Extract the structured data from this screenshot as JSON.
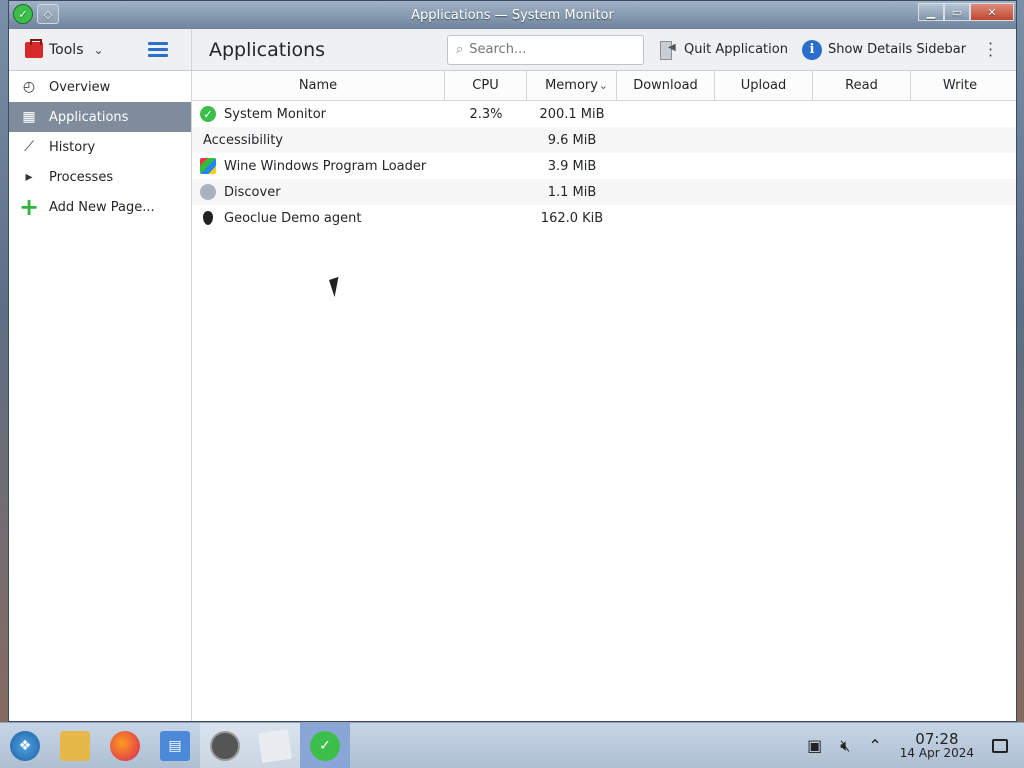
{
  "window": {
    "title": "Applications — System Monitor",
    "controls": {
      "minimize": "▁",
      "maximize": "▭",
      "close": "✕"
    }
  },
  "toolbar": {
    "tools_label": "Tools",
    "page_title": "Applications",
    "search_placeholder": "Search...",
    "quit_label": "Quit Application",
    "details_label": "Show Details Sidebar"
  },
  "sidebar": {
    "items": [
      {
        "label": "Overview",
        "icon": "gauge-icon",
        "selected": false
      },
      {
        "label": "Applications",
        "icon": "grid-icon",
        "selected": true
      },
      {
        "label": "History",
        "icon": "chart-icon",
        "selected": false
      },
      {
        "label": "Processes",
        "icon": "terminal-icon",
        "selected": false
      },
      {
        "label": "Add New Page...",
        "icon": "plus-icon",
        "selected": false
      }
    ]
  },
  "table": {
    "columns": [
      "Name",
      "CPU",
      "Memory",
      "Download",
      "Upload",
      "Read",
      "Write"
    ],
    "rows": [
      {
        "name": "System Monitor",
        "cpu": "2.3%",
        "memory": "200.1 MiB",
        "icon": "system-monitor-icon"
      },
      {
        "name": "Accessibility",
        "cpu": "",
        "memory": "9.6 MiB",
        "icon": ""
      },
      {
        "name": "Wine Windows Program Loader",
        "cpu": "",
        "memory": "3.9 MiB",
        "icon": "wine-icon"
      },
      {
        "name": "Discover",
        "cpu": "",
        "memory": "1.1 MiB",
        "icon": "discover-icon"
      },
      {
        "name": "Geoclue Demo agent",
        "cpu": "",
        "memory": "162.0 KiB",
        "icon": "geoclue-icon"
      }
    ]
  },
  "taskbar": {
    "apps": [
      "start-menu-icon",
      "file-manager-icon",
      "firefox-icon",
      "network-icon",
      "compass-icon",
      "blank-app-icon",
      "system-monitor-icon"
    ],
    "clock_time": "07:28",
    "clock_date": "14 Apr 2024"
  },
  "colors": {
    "selection": "#7f8c9c",
    "accent": "#2a6fcd",
    "taskbar_current": "#8aa6d6"
  }
}
